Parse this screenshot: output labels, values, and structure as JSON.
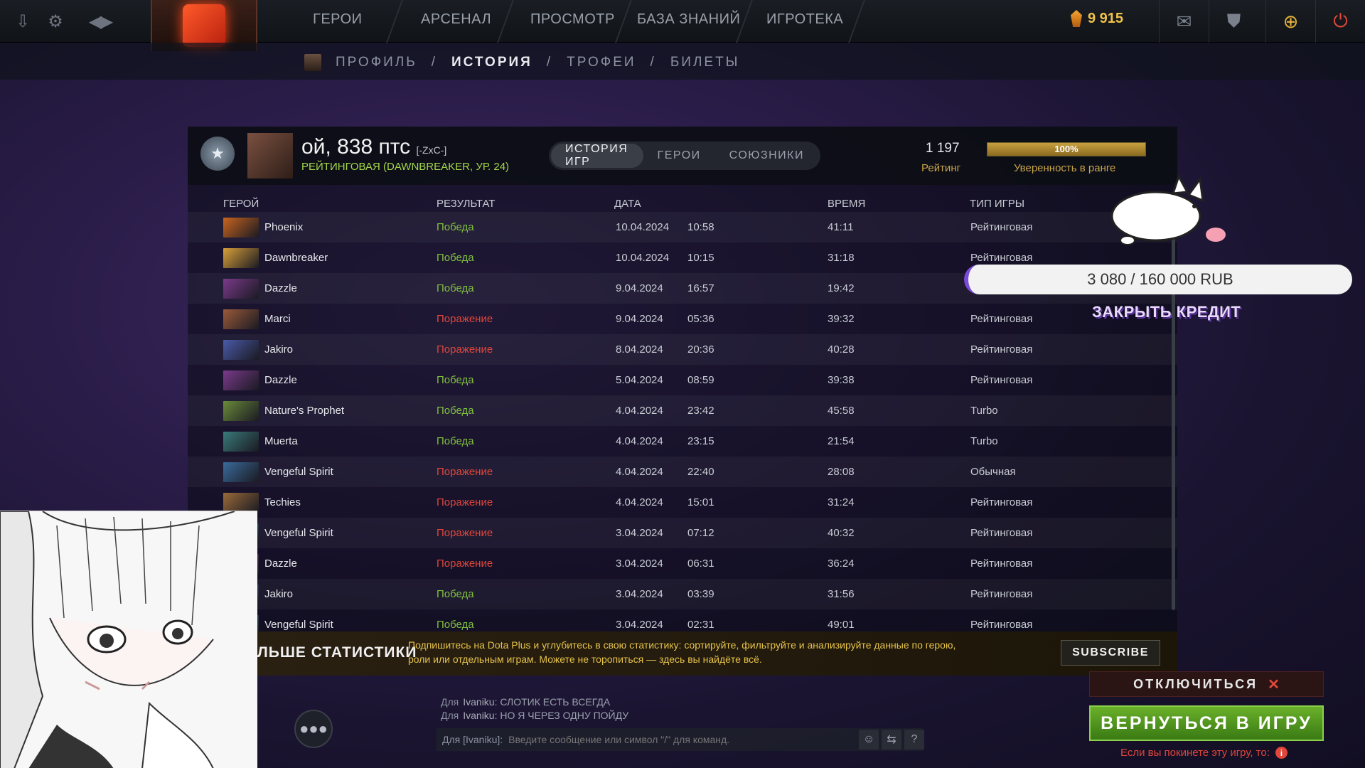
{
  "topbar": {
    "nav": [
      "ГЕРОИ",
      "АРСЕНАЛ",
      "ПРОСМОТР",
      "БАЗА ЗНАНИЙ",
      "ИГРОТЕКА"
    ],
    "currency": "9 915"
  },
  "breadcrumbs": [
    "ПРОФИЛЬ",
    "/",
    "ИСТОРИЯ",
    "/",
    "ТРОФЕИ",
    "/",
    "БИЛЕТЫ"
  ],
  "player": {
    "name": "ой, 838 птс",
    "tag": "[-ZxC-]",
    "subtitle": "РЕЙТИНГОВАЯ (DAWNBREAKER, УР. 24)"
  },
  "tabs": [
    "ИСТОРИЯ ИГР",
    "ГЕРОИ",
    "СОЮЗНИКИ"
  ],
  "rating": {
    "value": "1 197",
    "label": "Рейтинг"
  },
  "confidence": {
    "text": "100%",
    "label": "Уверенность в ранге",
    "fill": 1.0
  },
  "table": {
    "headers": [
      "ГЕРОЙ",
      "РЕЗУЛЬТАТ",
      "ДАТА",
      "ВРЕМЯ",
      "ТИП ИГРЫ"
    ],
    "rows": [
      {
        "hero": "Phoenix",
        "result": "Победа",
        "date": "10.04.2024",
        "time": "10:58",
        "duration": "41:11",
        "type": "Рейтинговая",
        "win": true,
        "color": "#c8641e"
      },
      {
        "hero": "Dawnbreaker",
        "result": "Победа",
        "date": "10.04.2024",
        "time": "10:15",
        "duration": "31:18",
        "type": "Рейтинговая",
        "win": true,
        "color": "#d8a03a"
      },
      {
        "hero": "Dazzle",
        "result": "Победа",
        "date": "9.04.2024",
        "time": "16:57",
        "duration": "19:42",
        "type": "",
        "win": true,
        "color": "#7a3a8a"
      },
      {
        "hero": "Marci",
        "result": "Поражение",
        "date": "9.04.2024",
        "time": "05:36",
        "duration": "39:32",
        "type": "Рейтинговая",
        "win": false,
        "color": "#9a5a3a"
      },
      {
        "hero": "Jakiro",
        "result": "Поражение",
        "date": "8.04.2024",
        "time": "20:36",
        "duration": "40:28",
        "type": "Рейтинговая",
        "win": false,
        "color": "#4a5aa8"
      },
      {
        "hero": "Dazzle",
        "result": "Победа",
        "date": "5.04.2024",
        "time": "08:59",
        "duration": "39:38",
        "type": "Рейтинговая",
        "win": true,
        "color": "#7a3a8a"
      },
      {
        "hero": "Nature's Prophet",
        "result": "Победа",
        "date": "4.04.2024",
        "time": "23:42",
        "duration": "45:58",
        "type": "Turbo",
        "win": true,
        "color": "#6a8a3a"
      },
      {
        "hero": "Muerta",
        "result": "Победа",
        "date": "4.04.2024",
        "time": "23:15",
        "duration": "21:54",
        "type": "Turbo",
        "win": true,
        "color": "#3a7a7a"
      },
      {
        "hero": "Vengeful Spirit",
        "result": "Поражение",
        "date": "4.04.2024",
        "time": "22:40",
        "duration": "28:08",
        "type": "Обычная",
        "win": false,
        "color": "#3a6a9a"
      },
      {
        "hero": "Techies",
        "result": "Поражение",
        "date": "4.04.2024",
        "time": "15:01",
        "duration": "31:24",
        "type": "Рейтинговая",
        "win": false,
        "color": "#9a6a3a"
      },
      {
        "hero": "Vengeful Spirit",
        "result": "Поражение",
        "date": "3.04.2024",
        "time": "07:12",
        "duration": "40:32",
        "type": "Рейтинговая",
        "win": false,
        "color": "#3a6a9a"
      },
      {
        "hero": "Dazzle",
        "result": "Поражение",
        "date": "3.04.2024",
        "time": "06:31",
        "duration": "36:24",
        "type": "Рейтинговая",
        "win": false,
        "color": "#7a3a8a"
      },
      {
        "hero": "Jakiro",
        "result": "Победа",
        "date": "3.04.2024",
        "time": "03:39",
        "duration": "31:56",
        "type": "Рейтинговая",
        "win": true,
        "color": "#4a5aa8"
      },
      {
        "hero": "Vengeful Spirit",
        "result": "Победа",
        "date": "3.04.2024",
        "time": "02:31",
        "duration": "49:01",
        "type": "Рейтинговая",
        "win": true,
        "color": "#3a6a9a"
      }
    ]
  },
  "plus": {
    "title": "ЛЬШЕ СТАТИСТИКИ",
    "desc": "Подпишитесь на Dota Plus и углубитесь в свою статистику: сортируйте, фильтруйте и анализируйте данные по герою, роли или отдельным играм. Можете не торопиться — здесь вы найдёте всё.",
    "subscribe": "SUBSCRIBE"
  },
  "chat": {
    "messages": [
      {
        "to": "Для",
        "nick": "Ivaniku",
        "text": ": СЛОТИК ЕСТЬ ВСЕГДА"
      },
      {
        "to": "Для",
        "nick": "Ivaniku",
        "text": ": НО Я ЧЕРЕЗ ОДНУ ПОЙДУ"
      }
    ],
    "target": "Для [Ivaniku]:",
    "placeholder": "Введите сообщение или символ \"/\" для команд."
  },
  "overlay": {
    "credit": "3 080 / 160 000 RUB",
    "credit_title": "ЗАКРЫТЬ КРЕДИТ"
  },
  "actions": {
    "disconnect": "ОТКЛЮЧИТЬСЯ",
    "return": "ВЕРНУТЬСЯ В ИГРУ",
    "warn": "Если вы покинете эту игру, то:"
  },
  "colors": {
    "win": "#80c03e",
    "loss": "#e0463a",
    "accent": "#c8a44a"
  }
}
